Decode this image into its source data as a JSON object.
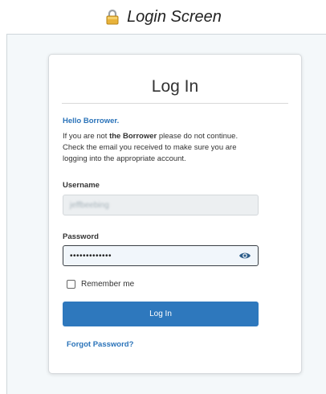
{
  "header": {
    "icon": "lock-icon",
    "title": "Login Screen"
  },
  "card": {
    "title": "Log In",
    "hello": "Hello Borrower.",
    "warning_prefix": "If you are not ",
    "warning_bold": "the Borrower",
    "warning_suffix": " please do not continue. Check the email you received to make sure you are logging into the appropriate account."
  },
  "form": {
    "username_label": "Username",
    "username_value": "jeffbeebing",
    "password_label": "Password",
    "password_value": "•••••••••••••",
    "password_toggle_icon": "eye-icon",
    "remember_label": "Remember me",
    "remember_checked": false,
    "login_button": "Log In",
    "forgot_link": "Forgot Password?"
  },
  "colors": {
    "accent": "#2e78bd",
    "link": "#2a73b9",
    "panel_bg": "#f4f8fa"
  }
}
